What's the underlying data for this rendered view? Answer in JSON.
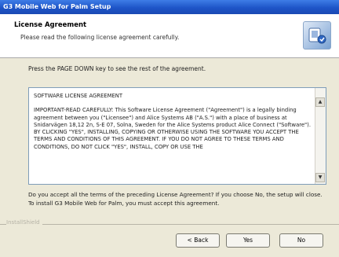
{
  "window": {
    "title": "G3 Mobile Web for Palm Setup"
  },
  "header": {
    "title": "License Agreement",
    "subtitle": "Please read the following license agreement carefully.",
    "icon": "setup-icon"
  },
  "instructions": "Press the PAGE DOWN key to see the rest of the agreement.",
  "license": {
    "heading": "SOFTWARE LICENSE AGREEMENT",
    "body": "IMPORTANT-READ CAREFULLY: This Software License Agreement (\"Agreement\") is a legally binding agreement between you (\"Licensee\") and Alice Systems AB (\"A.S.\") with a place of business at Snidarvägen 18,12 2n, S-E 07, Solna, Sweden for the Alice Systems product Alice Connect (\"Software\"). BY CLICKING \"YES\", INSTALLING, COPYING OR OTHERWISE USING THE SOFTWARE YOU ACCEPT THE TERMS AND CONDITIONS OF THIS AGREEMENT. IF YOU DO NOT AGREE TO THESE TERMS AND CONDITIONS, DO NOT CLICK \"YES\", INSTALL, COPY OR USE THE"
  },
  "question": "Do you accept all the terms of the preceding License Agreement? If you choose No, the setup will close. To install G3 Mobile Web for Palm, you must accept this agreement.",
  "brand": "InstallShield",
  "buttons": {
    "back": "< Back",
    "yes": "Yes",
    "no": "No"
  }
}
